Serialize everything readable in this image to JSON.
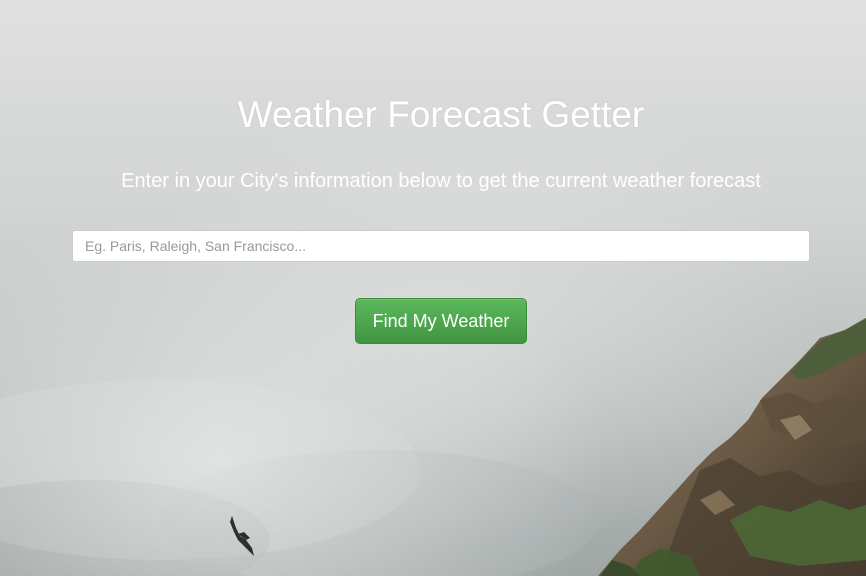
{
  "page": {
    "title": "Weather Forecast Getter",
    "subtitle": "Enter in your City's information below to get the current weather forecast"
  },
  "search": {
    "value": "",
    "placeholder": "Eg. Paris, Raleigh, San Francisco..."
  },
  "actions": {
    "find_label": "Find My Weather"
  },
  "colors": {
    "button_green": "#4cae4c",
    "text_white": "#ffffff",
    "fog_light": "#dfe1e1",
    "fog_mid": "#b6bcbb",
    "cliff_brown": "#7d6a52",
    "cliff_green": "#4f6b3a"
  },
  "background": {
    "description_icons": [
      "foggy-sky",
      "rocky-cliff",
      "bird-silhouette"
    ]
  }
}
